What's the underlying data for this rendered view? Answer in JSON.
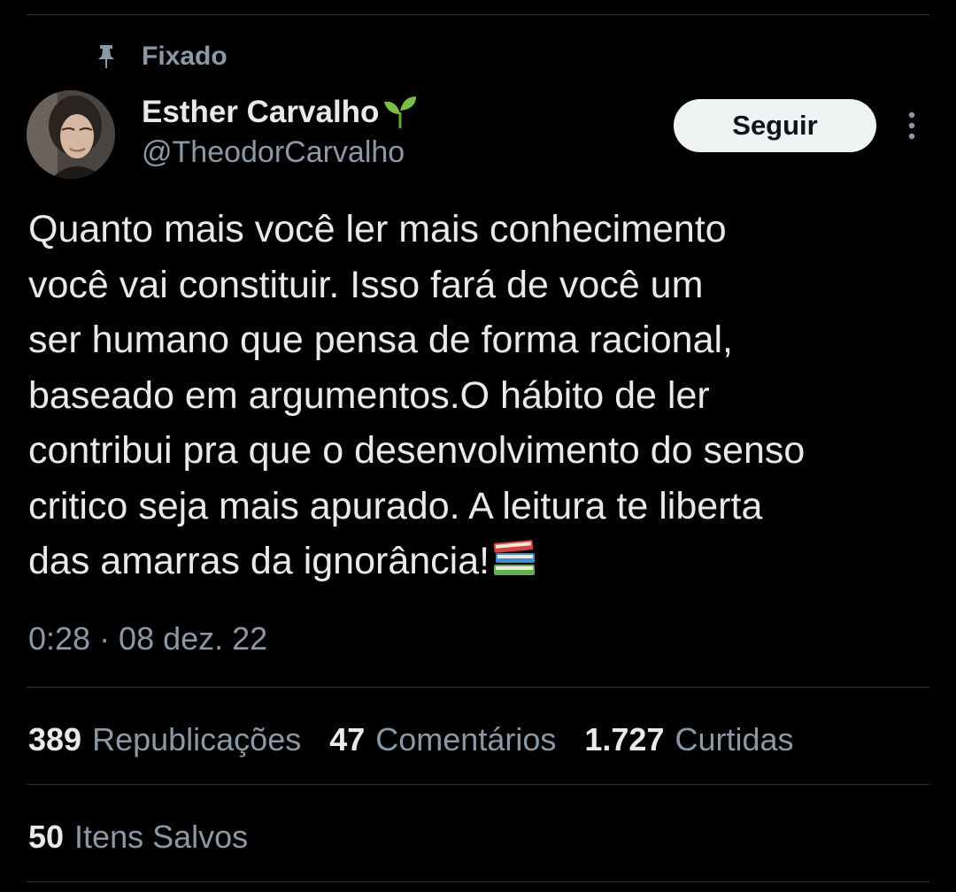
{
  "tweet": {
    "pinned_label": "Fixado",
    "author": {
      "display_name": "Esther Carvalho",
      "handle": "@TheodorCarvalho",
      "name_emoji_icon": "seedling-icon"
    },
    "follow_label": "Seguir",
    "text_lines": [
      "Quanto mais você ler mais conhecimento",
      "você vai constituir. Isso fará de você um",
      "ser humano que pensa de forma racional,",
      "baseado em argumentos.O hábito de ler",
      "contribui pra que o desenvolvimento do senso",
      "critico seja mais apurado. A leitura te liberta",
      "das amarras da ignorância!"
    ],
    "text_emoji_icon": "books-icon",
    "timestamp": "0:28 · 08 dez. 22",
    "stats": {
      "reposts": {
        "count": "389",
        "label": "Republicações"
      },
      "comments": {
        "count": "47",
        "label": "Comentários"
      },
      "likes": {
        "count": "1.727",
        "label": "Curtidas"
      },
      "bookmarks": {
        "count": "50",
        "label": "Itens Salvos"
      }
    }
  },
  "colors": {
    "background": "#000000",
    "primary_text": "#e7e9ea",
    "secondary_text": "#8b98a5",
    "divider": "#2f3336",
    "follow_button_bg": "#eff3f4",
    "follow_button_text": "#0f1419"
  }
}
